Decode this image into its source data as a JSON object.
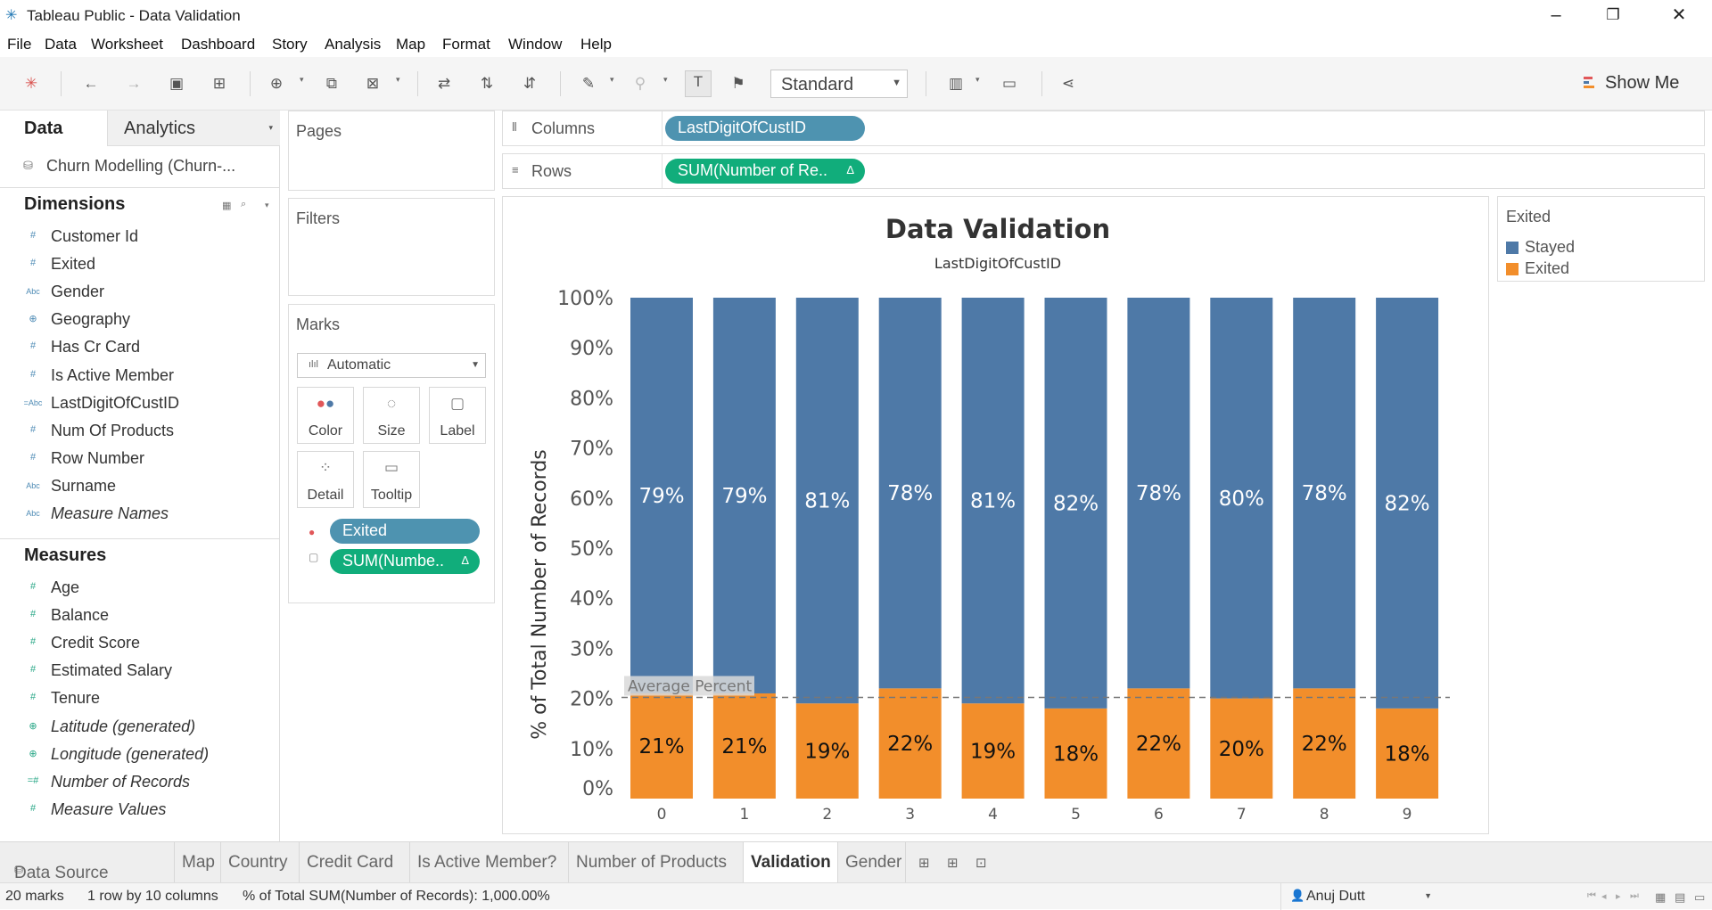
{
  "window": {
    "title": "Tableau Public - Data Validation"
  },
  "menu": [
    "File",
    "Data",
    "Worksheet",
    "Dashboard",
    "Story",
    "Analysis",
    "Map",
    "Format",
    "Window",
    "Help"
  ],
  "toolbar": {
    "fit_mode": "Standard",
    "show_me_label": "Show Me"
  },
  "data_pane": {
    "tab_data": "Data",
    "tab_analytics": "Analytics",
    "datasource": "Churn Modelling (Churn-...",
    "dimensions_header": "Dimensions",
    "dimensions": [
      {
        "name": "Customer Id",
        "type": "#"
      },
      {
        "name": "Exited",
        "type": "#"
      },
      {
        "name": "Gender",
        "type": "Abc"
      },
      {
        "name": "Geography",
        "type": "geo"
      },
      {
        "name": "Has Cr Card",
        "type": "#"
      },
      {
        "name": "Is Active Member",
        "type": "#"
      },
      {
        "name": "LastDigitOfCustID",
        "type": "=Abc"
      },
      {
        "name": "Num Of Products",
        "type": "#"
      },
      {
        "name": "Row Number",
        "type": "#"
      },
      {
        "name": "Surname",
        "type": "Abc"
      },
      {
        "name": "Measure Names",
        "type": "Abc",
        "italic": true
      }
    ],
    "measures_header": "Measures",
    "measures": [
      {
        "name": "Age",
        "type": "#"
      },
      {
        "name": "Balance",
        "type": "#"
      },
      {
        "name": "Credit Score",
        "type": "#"
      },
      {
        "name": "Estimated Salary",
        "type": "#"
      },
      {
        "name": "Tenure",
        "type": "#"
      },
      {
        "name": "Latitude (generated)",
        "type": "geo",
        "italic": true
      },
      {
        "name": "Longitude (generated)",
        "type": "geo",
        "italic": true
      },
      {
        "name": "Number of Records",
        "type": "=#",
        "italic": true
      },
      {
        "name": "Measure Values",
        "type": "#",
        "italic": true
      }
    ]
  },
  "cards": {
    "pages": "Pages",
    "filters": "Filters",
    "marks": "Marks",
    "mark_type": "Automatic",
    "buttons": [
      "Color",
      "Size",
      "Label",
      "Detail",
      "Tooltip"
    ],
    "pill_color": "Exited",
    "pill_label": "SUM(Numbe..",
    "delta": "Δ"
  },
  "shelves": {
    "columns_label": "Columns",
    "columns_pill": "LastDigitOfCustID",
    "rows_label": "Rows",
    "rows_pill": "SUM(Number of Re.."
  },
  "legend": {
    "title": "Exited",
    "items": [
      {
        "label": "Stayed",
        "color": "#4e79a7"
      },
      {
        "label": "Exited",
        "color": "#f28e2b"
      }
    ]
  },
  "chart_data": {
    "type": "bar",
    "stacked": true,
    "title": "Data Validation",
    "subtitle": "LastDigitOfCustID",
    "xlabel": "LastDigitOfCustID",
    "ylabel": "% of Total Number of Records",
    "categories": [
      "0",
      "1",
      "2",
      "3",
      "4",
      "5",
      "6",
      "7",
      "8",
      "9"
    ],
    "series": [
      {
        "name": "Exited",
        "color": "#f28e2b",
        "values": [
          21,
          21,
          19,
          22,
          19,
          18,
          22,
          20,
          22,
          18
        ]
      },
      {
        "name": "Stayed",
        "color": "#4e79a7",
        "values": [
          79,
          79,
          81,
          78,
          81,
          82,
          78,
          80,
          78,
          82
        ]
      }
    ],
    "ylim": [
      0,
      100
    ],
    "y_ticks": [
      "100%",
      "90%",
      "80%",
      "70%",
      "60%",
      "50%",
      "40%",
      "30%",
      "20%",
      "10%",
      "0%"
    ],
    "y_tick_values": [
      100,
      90,
      80,
      70,
      60,
      50,
      40,
      30,
      20,
      10,
      0
    ],
    "reference_line": {
      "label": "Average Percent",
      "value": 20.2
    },
    "grid": false
  },
  "sheet_tabs": [
    "Data Source",
    "Map",
    "Country",
    "Credit Card",
    "Is Active Member?",
    "Number of Products",
    "Validation",
    "Gender"
  ],
  "active_tab": "Validation",
  "status": {
    "marks": "20 marks",
    "dims": "1 row by 10 columns",
    "summary": "% of Total SUM(Number of Records): 1,000.00%",
    "user": "Anuj Dutt"
  }
}
